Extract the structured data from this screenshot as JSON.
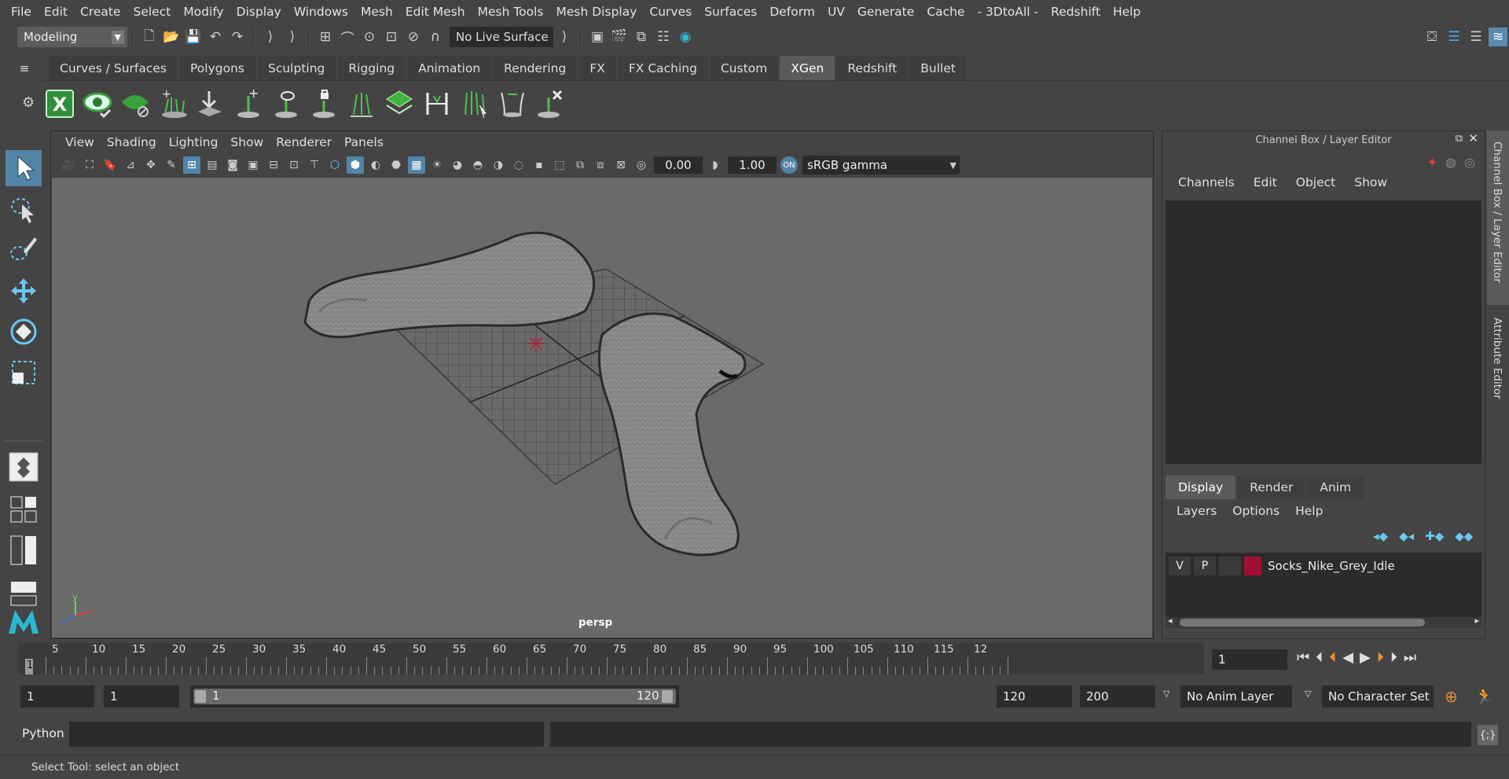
{
  "menubar": [
    "File",
    "Edit",
    "Create",
    "Select",
    "Modify",
    "Display",
    "Windows",
    "Mesh",
    "Edit Mesh",
    "Mesh Tools",
    "Mesh Display",
    "Curves",
    "Surfaces",
    "Deform",
    "UV",
    "Generate",
    "Cache",
    "- 3DtoAll -",
    "Redshift",
    "Help"
  ],
  "status": {
    "mode": "Modeling",
    "live_surface": "No Live Surface"
  },
  "shelf_tabs": [
    "Curves / Surfaces",
    "Polygons",
    "Sculpting",
    "Rigging",
    "Animation",
    "Rendering",
    "FX",
    "FX Caching",
    "Custom",
    "XGen",
    "Redshift",
    "Bullet"
  ],
  "active_shelf_tab": "XGen",
  "viewport": {
    "menu": [
      "View",
      "Shading",
      "Lighting",
      "Show",
      "Renderer",
      "Panels"
    ],
    "exposure": "0.00",
    "gamma": "1.00",
    "color_space": "sRGB gamma",
    "camera_label": "persp"
  },
  "channel_box": {
    "title": "Channel Box / Layer Editor",
    "menu": [
      "Channels",
      "Edit",
      "Object",
      "Show"
    ]
  },
  "layer_editor": {
    "tabs": [
      "Display",
      "Render",
      "Anim"
    ],
    "active_tab": "Display",
    "menu": [
      "Layers",
      "Options",
      "Help"
    ],
    "layers": [
      {
        "v": "V",
        "p": "P",
        "color": "#a01030",
        "name": "Socks_Nike_Grey_Idle"
      }
    ]
  },
  "side_tabs": [
    "Channel Box / Layer Editor",
    "Attribute Editor"
  ],
  "timeline": {
    "ticks": [
      "5",
      "10",
      "15",
      "20",
      "25",
      "30",
      "35",
      "40",
      "45",
      "50",
      "55",
      "60",
      "65",
      "70",
      "75",
      "80",
      "85",
      "90",
      "95",
      "100",
      "105",
      "110",
      "115",
      "12"
    ],
    "current_frame_marker": "1",
    "current_frame_field": "1"
  },
  "range": {
    "start": "1",
    "playback_start": "1",
    "slider_start": "1",
    "slider_end": "120",
    "playback_end": "120",
    "end": "200",
    "anim_layer": "No Anim Layer",
    "character_set": "No Character Set"
  },
  "command": {
    "language": "Python"
  },
  "help_line": "Select Tool: select an object"
}
